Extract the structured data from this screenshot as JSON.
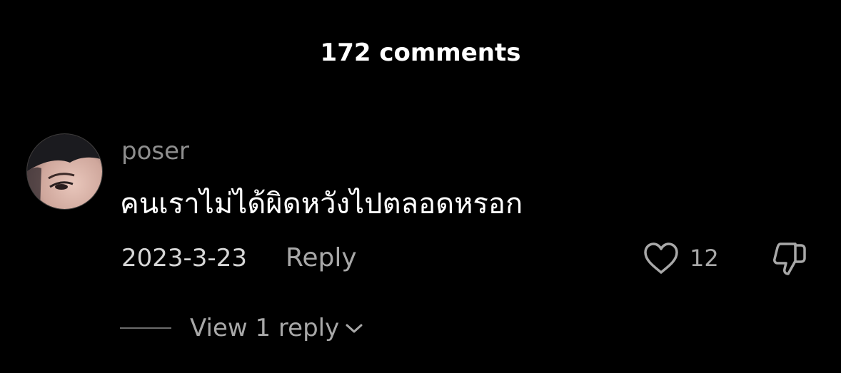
{
  "header": {
    "title": "172 comments"
  },
  "comment": {
    "username": "poser",
    "text": "คนเราไม่ได้ผิดหวังไปตลอดหรอก",
    "date": "2023-3-23",
    "reply_label": "Reply",
    "like_count": "12",
    "view_replies_label": "View 1 reply",
    "icons": {
      "like": "heart-icon",
      "dislike": "thumbs-down-icon",
      "expand": "chevron-down-icon"
    }
  },
  "colors": {
    "background": "#000000",
    "primary_text": "#ffffff",
    "secondary_text": "#8e8e8e",
    "muted_text": "#a8a8a8"
  }
}
